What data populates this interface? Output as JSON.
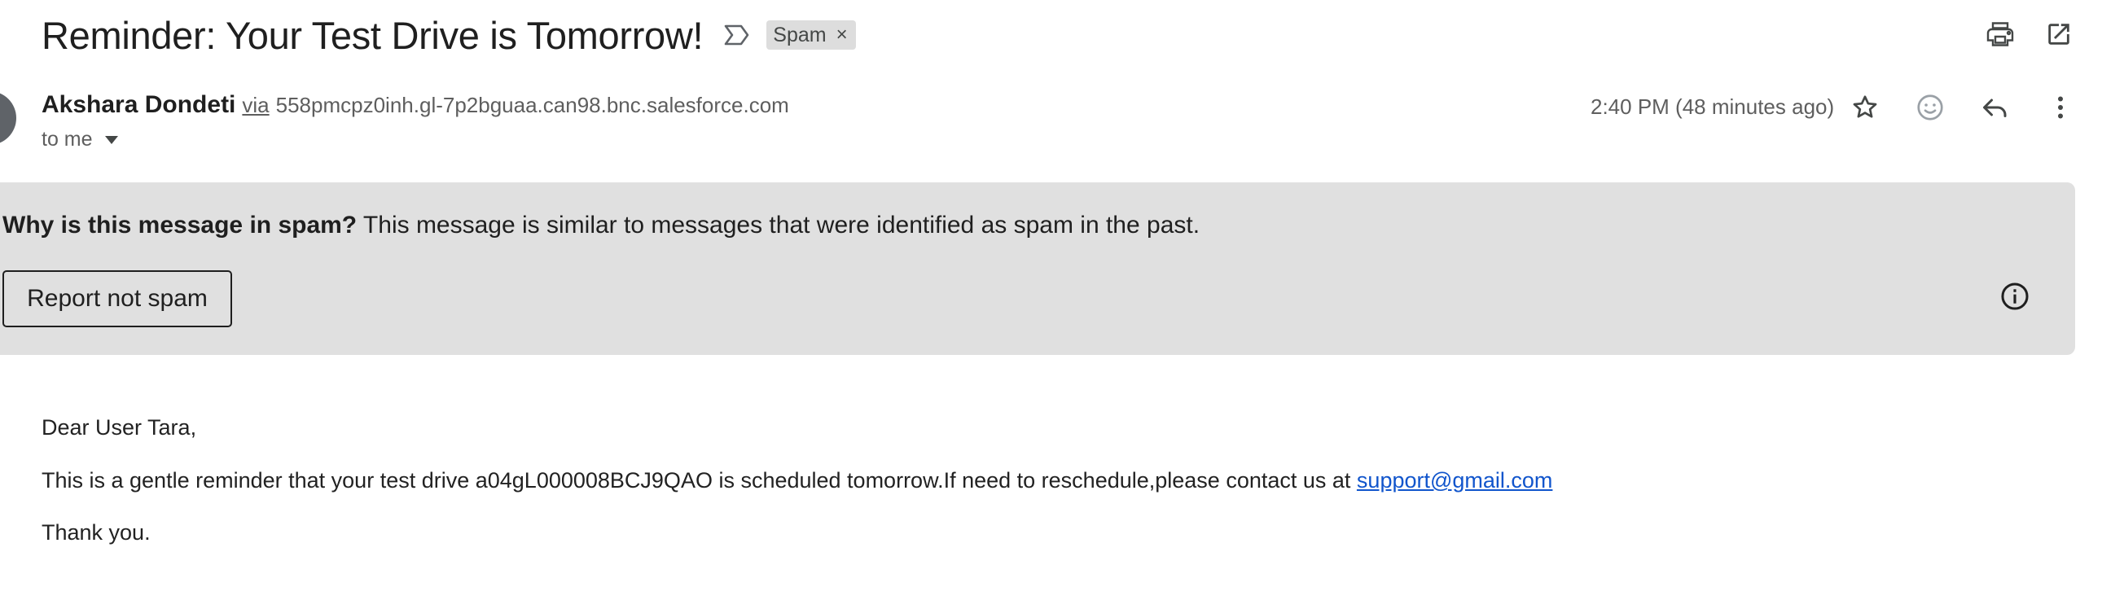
{
  "subject": {
    "title": "Reminder: Your Test Drive is Tomorrow!",
    "label_chip": "Spam",
    "label_remove": "×"
  },
  "toolbar": {
    "print_icon": "print-icon",
    "open_new_window_icon": "open-in-new-icon"
  },
  "sender": {
    "name": "Akshara Dondeti",
    "via_label": "via",
    "via_domain": "558pmcpz0inh.gl-7p2bguaa.can98.bnc.salesforce.com",
    "recipient": "to me",
    "timestamp": "2:40 PM (48 minutes ago)"
  },
  "message_actions": {
    "star_icon": "star-icon",
    "emoji_icon": "emoji-reaction-icon",
    "reply_icon": "reply-icon",
    "more_icon": "more-vert-icon"
  },
  "spam_banner": {
    "reason_title": "Why is this message in spam?",
    "reason_text": " This message is similar to messages that were identified as spam in the past.",
    "report_button": "Report not spam",
    "info_icon": "info-icon"
  },
  "body": {
    "greeting": "Dear User Tara,",
    "main_text": "This is a gentle reminder that your test drive a04gL000008BCJ9QAO is scheduled tomorrow.If need to reschedule,please contact us at ",
    "support_email": "support@gmail.com",
    "closing": "Thank you."
  },
  "colors": {
    "banner_bg": "#e0e0e0",
    "chip_bg": "#dddddd",
    "link": "#1155cc",
    "secondary_text": "#5e5e5e"
  }
}
